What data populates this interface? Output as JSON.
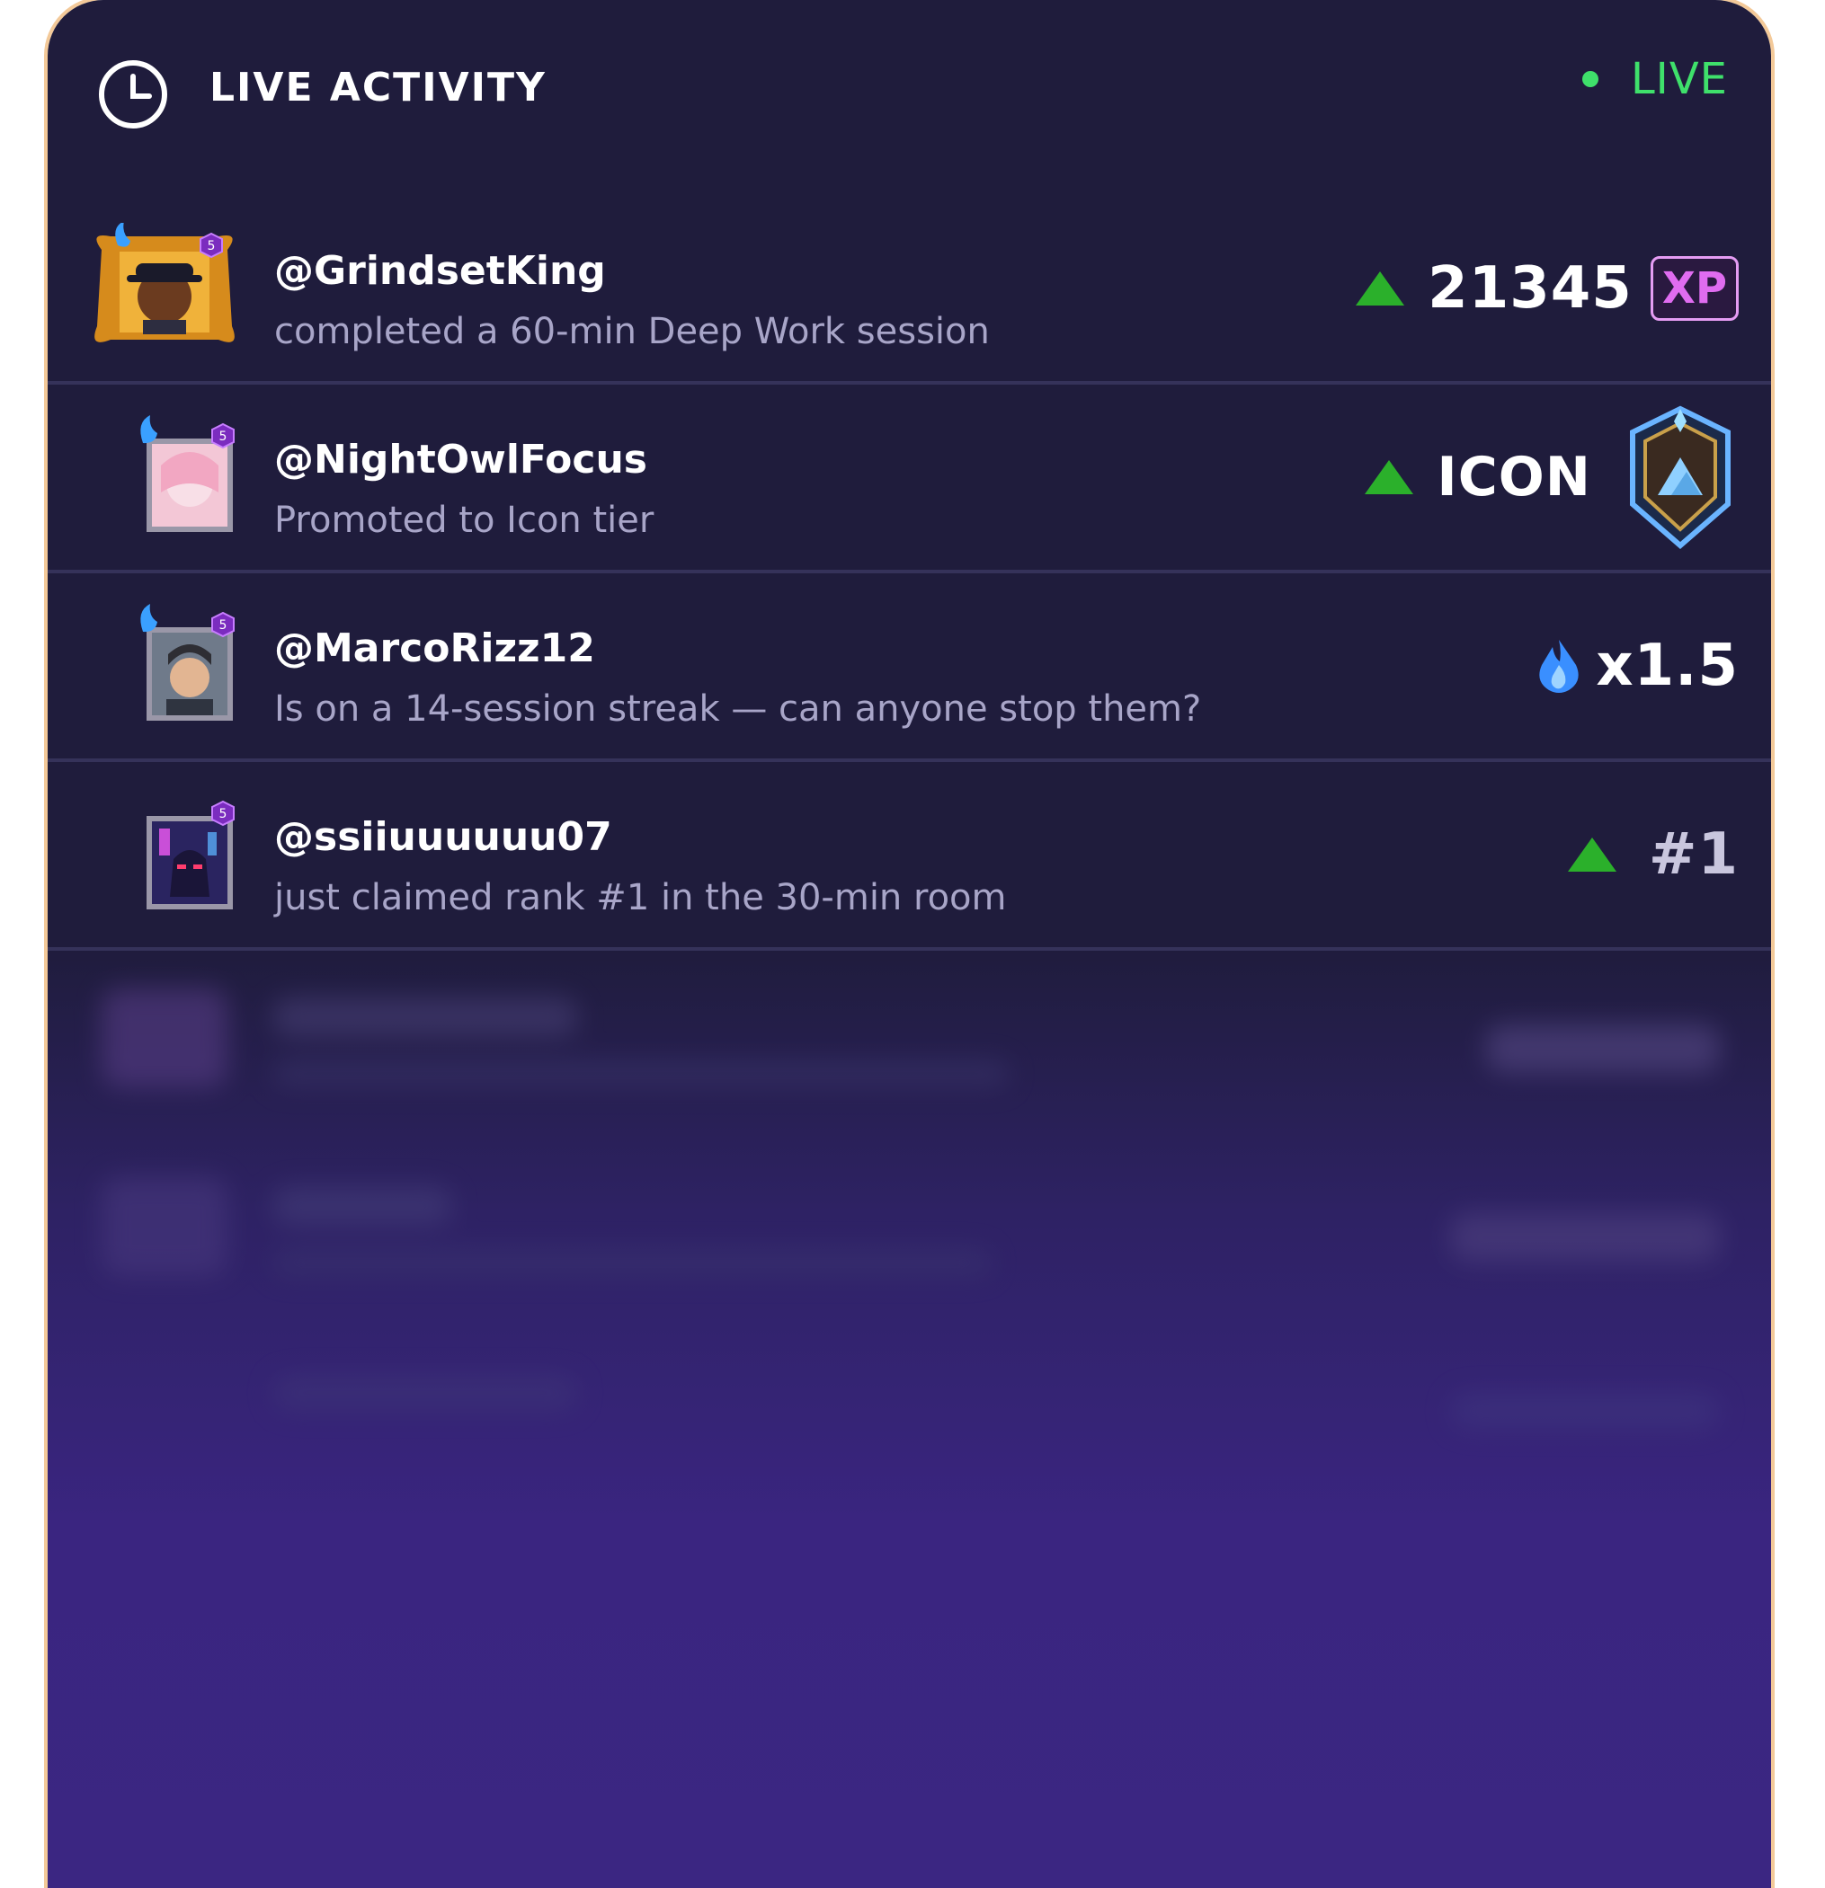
{
  "header": {
    "title": "LIVE ACTIVITY",
    "status": "LIVE"
  },
  "colors": {
    "live": "#3fe06b",
    "up_arrow": "#2bb02b",
    "xp_badge": "#e06cf0",
    "border": "#f3c999"
  },
  "feed": [
    {
      "username": "@GrindsetKing",
      "text": "completed a 60-min Deep Work session",
      "value": "21345",
      "badge": "XP",
      "avatar_level": "5",
      "trend": "up"
    },
    {
      "username": "@NightOwlFocus",
      "text": "Promoted to Icon tier",
      "value": "ICON",
      "avatar_level": "5",
      "trend": "up"
    },
    {
      "username": "@MarcoRizz12",
      "text": "Is on a 14-session streak — can anyone stop them?",
      "value": "x1.5",
      "avatar_level": "5",
      "trend": "streak"
    },
    {
      "username": "@ssiiuuuuuu07",
      "text": "just claimed rank #1 in the 30-min room",
      "value": "#1",
      "avatar_level": "5",
      "trend": "up"
    }
  ]
}
